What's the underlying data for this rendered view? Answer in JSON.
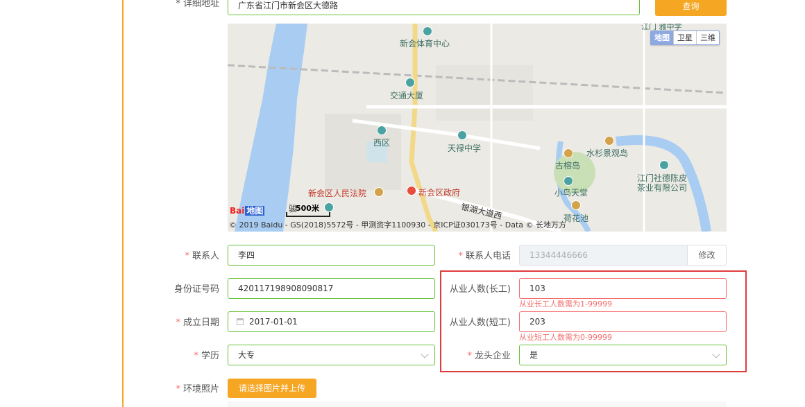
{
  "address": {
    "label": "* 详细地址",
    "value": "广东省江门市新会区大德路",
    "search_button": "查询"
  },
  "map": {
    "types": [
      "地图",
      "卫星",
      "三维"
    ],
    "pois": {
      "sports": "新会体育中心",
      "jiaotong": "交通大厦",
      "xiqu": "西区",
      "tianlu": "天禄中学",
      "shuishan": "水杉景观岛",
      "gurong": "古榕岛",
      "xiaoniao": "小鸟天堂",
      "hehua": "荷花池",
      "court": "新会区人民法院",
      "gov": "新会区政府",
      "road": "银湖大道西",
      "tea": "江门社德陈皮",
      "tea2": "茶业有限公司",
      "top": "江门   雅中学",
      "xiao": "骏"
    },
    "logo": "Bai",
    "logo_suffix": "地图",
    "scale": "500米",
    "copyright": "© 2019 Baidu - GS(2018)5572号 - 甲测资字1100930 - 京ICP证030173号 - Data © 长地万方"
  },
  "form": {
    "contact": {
      "label": "联系人",
      "value": "李四"
    },
    "phone": {
      "label": "联系人电话",
      "value": "13344446666",
      "edit_button": "修改"
    },
    "id_number": {
      "label": "身份证号码",
      "value": "420117198908090817"
    },
    "long_term": {
      "label": "从业人数(长工)",
      "value": "103",
      "error": "从业长工人数需为1-99999"
    },
    "founded": {
      "label": "成立日期",
      "value": "2017-01-01"
    },
    "short_term": {
      "label": "从业人数(短工)",
      "value": "203",
      "error": "从业短工人数需为0-99999"
    },
    "education": {
      "label": "学历",
      "value": "大专"
    },
    "leading": {
      "label": "龙头企业",
      "value": "是"
    },
    "photos": {
      "label": "环境照片",
      "upload_button": "请选择图片并上传"
    }
  }
}
